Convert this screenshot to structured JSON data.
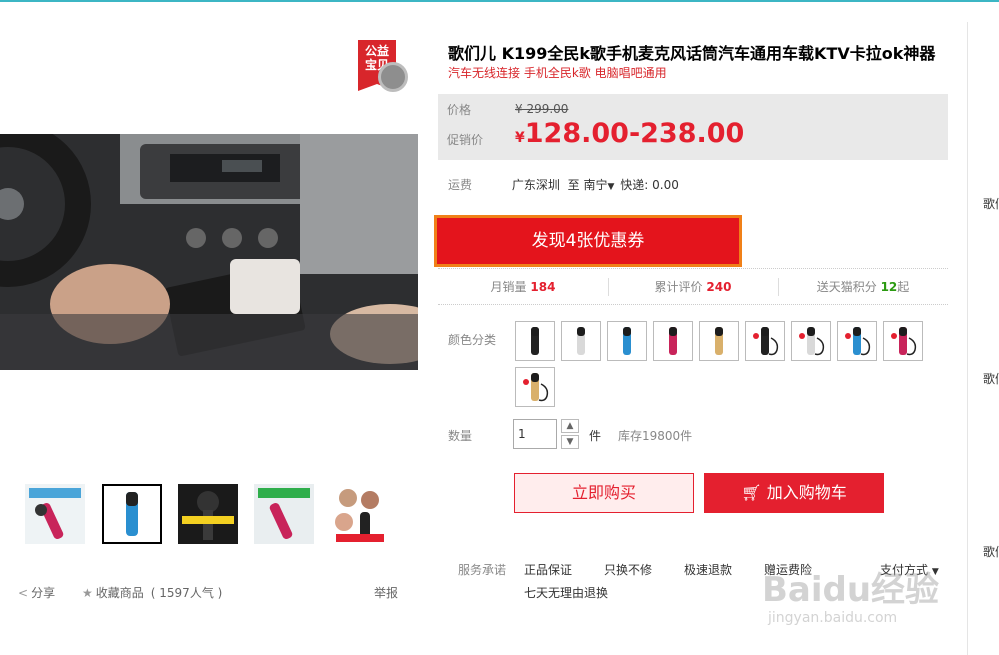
{
  "badge": {
    "line1": "公益",
    "line2": "宝贝"
  },
  "product": {
    "title": "歌们儿 K199全民k歌手机麦克风话筒汽车通用车载KTV卡拉ok神器",
    "subtitle": "汽车无线连接 手机全民k歌 电脑唱吧通用"
  },
  "price": {
    "label": "价格",
    "original": "¥ 299.00",
    "promo_label": "促销价",
    "promo_currency": "¥",
    "promo_value": "128.00-238.00"
  },
  "shipping": {
    "label": "运费",
    "from": "广东深圳",
    "to_prefix": "至",
    "to": "南宁",
    "fee": "快递: 0.00"
  },
  "coupon": {
    "label": "发现4张优惠券"
  },
  "stats": {
    "monthly_sales_label": "月销量",
    "monthly_sales_value": "184",
    "reviews_label": "累计评价",
    "reviews_value": "240",
    "points_label": "送天猫积分",
    "points_value": "12",
    "points_suffix": "起"
  },
  "colors": {
    "label": "颜色分类",
    "swatches": [
      {
        "body": "#222222"
      },
      {
        "body": "#d9d9d9"
      },
      {
        "body": "#2a8fd0"
      },
      {
        "body": "#c8245a"
      },
      {
        "body": "#d9b06b"
      },
      {
        "body": "#222222"
      },
      {
        "body": "#d9d9d9"
      },
      {
        "body": "#2a8fd0"
      },
      {
        "body": "#c8245a"
      },
      {
        "body": "#d9b06b"
      }
    ]
  },
  "quantity": {
    "label": "数量",
    "value": "1",
    "unit": "件",
    "stock": "库存19800件"
  },
  "buttons": {
    "buy_now": "立即购买",
    "add_cart": "加入购物车"
  },
  "services": {
    "label": "服务承诺",
    "items": [
      "正品保证",
      "只换不修",
      "极速退款",
      "赠运费险",
      "七天无理由退换"
    ],
    "payment": "支付方式"
  },
  "share": {
    "share_label": "分享",
    "fav_label": "收藏商品",
    "fav_count": "( 1597人气 )",
    "report": "举报"
  },
  "right_col": {
    "label": "歌们"
  },
  "watermark": {
    "main": "Baidu经验",
    "url": "jingyan.baidu.com"
  },
  "colors_theme": {
    "accent": "#e4202f",
    "coupon_border": "#f08018",
    "green": "#2b9a11"
  }
}
